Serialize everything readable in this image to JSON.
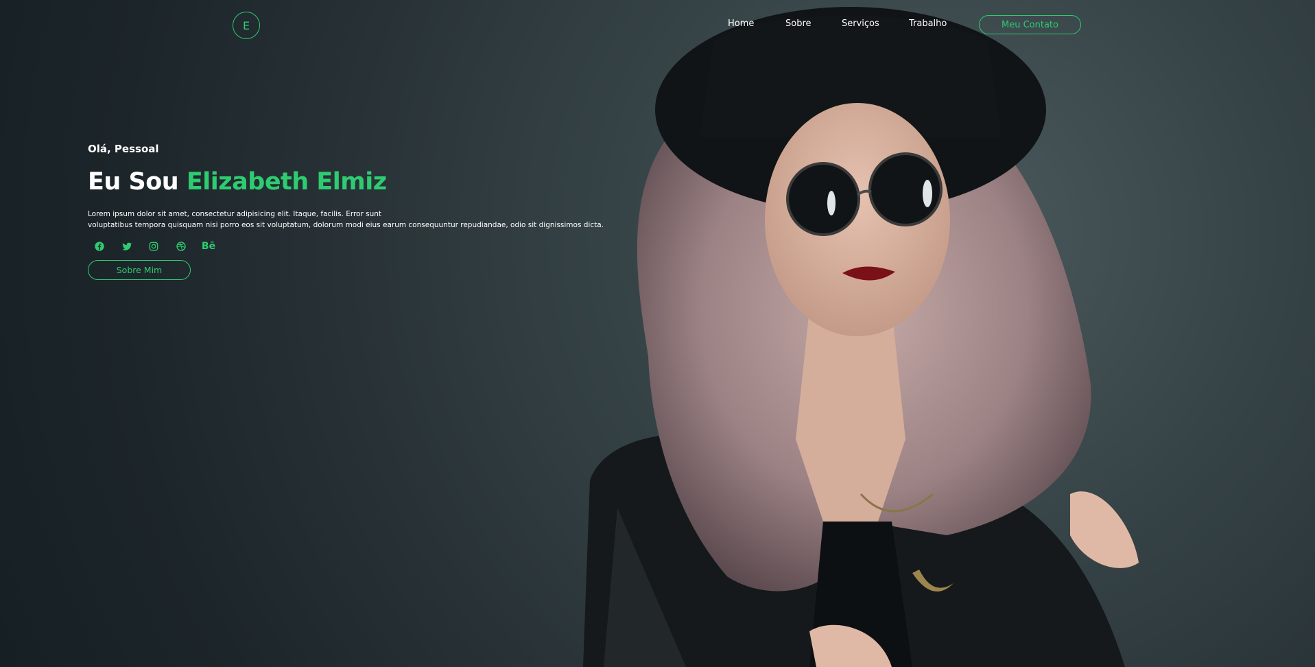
{
  "logo": {
    "letter": "E"
  },
  "nav": {
    "items": [
      "Home",
      "Sobre",
      "Serviços",
      "Trabalho"
    ],
    "contact_label": "Meu Contato"
  },
  "hero": {
    "greeting": "Olá, Pessoal",
    "title_prefix": "Eu Sou",
    "title_name": "Elizabeth Elmiz",
    "description_line1": "Lorem ipsum dolor sit amet, consectetur adipisicing elit. Itaque, facilis. Error sunt",
    "description_line2": "voluptatibus tempora quisquam nisi porro eos sit voluptatum, dolorum modi eius earum consequuntur repudiandae, odio sit dignissimos dicta.",
    "about_label": "Sobre Mim"
  },
  "socials": [
    {
      "icon": "facebook-icon"
    },
    {
      "icon": "twitter-icon"
    },
    {
      "icon": "instagram-icon"
    },
    {
      "icon": "dribbble-icon"
    },
    {
      "icon": "behance-icon",
      "glyph": "Bē"
    }
  ],
  "colors": {
    "accent": "#2ecc71",
    "background": "#283236",
    "text": "#ffffff"
  }
}
